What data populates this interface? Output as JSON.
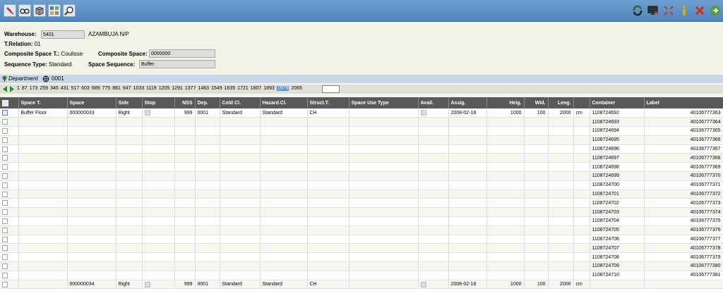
{
  "toolbar": {
    "left_icons": [
      "pin-icon",
      "glasses-icon",
      "box-icon",
      "grid-icon",
      "magnifier-icon"
    ],
    "right_icons": [
      "refresh-icon",
      "monitor-icon",
      "expand-icon",
      "info-icon",
      "close-icon",
      "exit-icon"
    ]
  },
  "form": {
    "warehouse_label": "Warehouse:",
    "warehouse_value": "5401",
    "warehouse_name": "AZAMBUJA N/P",
    "trelation_label": "T.Relation:",
    "trelation_value": "01",
    "cst_label": "Composite Space T.:",
    "cst_value": "Coulisse",
    "cs_label": "Composite Space:",
    "cs_value": "0000000",
    "seqtype_label": "Sequence Type:",
    "seqtype_value": "Standard",
    "spaceseq_label": "Space Sequence:",
    "spaceseq_value": "Buffer"
  },
  "department": {
    "label": "Department",
    "value": "0001"
  },
  "pagination": {
    "pages": [
      "1",
      "87",
      "173",
      "259",
      "345",
      "431",
      "517",
      "603",
      "689",
      "775",
      "861",
      "947",
      "1033",
      "1119",
      "1205",
      "1291",
      "1377",
      "1463",
      "1549",
      "1635",
      "1721",
      "1807",
      "1893",
      "1979",
      "2065"
    ],
    "selected": "1979"
  },
  "table": {
    "headers": [
      "Space T.",
      "Space",
      "Side",
      "Stop",
      "NSS",
      "Dep.",
      "Cold Cl.",
      "Hazard.Cl.",
      "Struct.T.",
      "Space Use Type",
      "Avail.",
      "Assig.",
      "Heig.",
      "Wid.",
      "Leng.",
      "",
      "Container",
      "Label"
    ],
    "first": {
      "space_t": "Buffer Floor",
      "space": "000000033",
      "side": "Right",
      "nss": "999",
      "dep": "0001",
      "cold": "Standard",
      "hazard": "Standard",
      "struct": "CH",
      "assig": "2008-02-18",
      "heig": "1000",
      "wid": "100",
      "leng": "2000",
      "unit": "cm"
    },
    "rows": [
      {
        "container": "1108724692",
        "label": "40106777363"
      },
      {
        "container": "1108724693",
        "label": "40106777364"
      },
      {
        "container": "1108724694",
        "label": "40106777365"
      },
      {
        "container": "1108724695",
        "label": "40106777366"
      },
      {
        "container": "1108724696",
        "label": "40106777367"
      },
      {
        "container": "1108724697",
        "label": "40106777368"
      },
      {
        "container": "1108724698",
        "label": "40106777369"
      },
      {
        "container": "1108724699",
        "label": "40106777370"
      },
      {
        "container": "1108724700",
        "label": "40106777371"
      },
      {
        "container": "1108724701",
        "label": "40106777372"
      },
      {
        "container": "1108724702",
        "label": "40106777373"
      },
      {
        "container": "1108724703",
        "label": "40106777374"
      },
      {
        "container": "1108724704",
        "label": "40106777375"
      },
      {
        "container": "1108724705",
        "label": "40106777376"
      },
      {
        "container": "1108724706",
        "label": "40106777377"
      },
      {
        "container": "1108724707",
        "label": "40106777378"
      },
      {
        "container": "1108724708",
        "label": "40106777379"
      },
      {
        "container": "1108724709",
        "label": "40106777380"
      },
      {
        "container": "1108724710",
        "label": "40106777381"
      }
    ],
    "last": {
      "space": "000000034",
      "side": "Right",
      "nss": "999",
      "dep": "0001",
      "cold": "Standard",
      "hazard": "Standard",
      "struct": "CH",
      "assig": "2008-02-18",
      "heig": "1000",
      "wid": "100",
      "leng": "2000",
      "unit": "cm"
    }
  }
}
